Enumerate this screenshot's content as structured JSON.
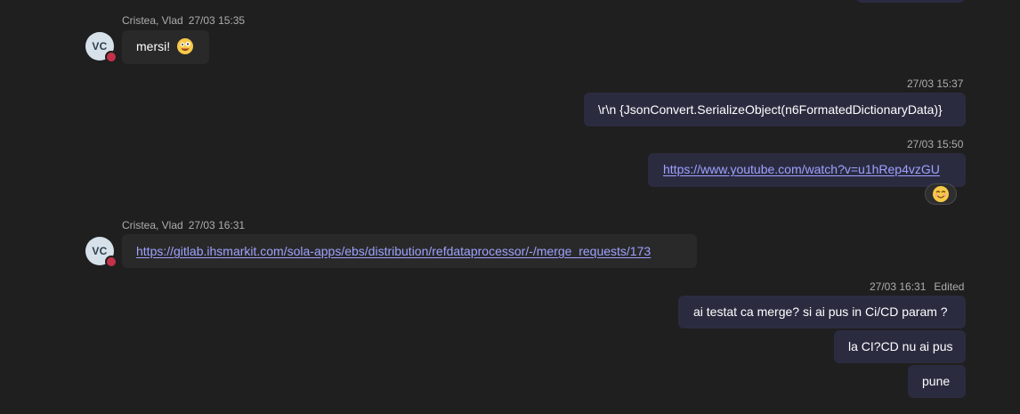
{
  "messages": {
    "msg1": {
      "sender": "Cristea, Vlad",
      "time": "27/03 15:35",
      "avatar": "VC",
      "text": "mersi!",
      "emoji": "zany-face-emoji"
    },
    "msg2": {
      "time": "27/03 15:37",
      "text": "\\r\\n {JsonConvert.SerializeObject(n6FormatedDictionaryData)}"
    },
    "msg3": {
      "time": "27/03 15:50",
      "link": "https://www.youtube.com/watch?v=u1hRep4vzGU",
      "reaction": "smiling-face-emoji"
    },
    "msg4": {
      "sender": "Cristea, Vlad",
      "time": "27/03 16:31",
      "avatar": "VC",
      "link": "https://gitlab.ihsmarkit.com/sola-apps/ebs/distribution/refdataprocessor/-/merge_requests/173"
    },
    "msg5": {
      "time": "27/03 16:31",
      "edited": "Edited",
      "lines": [
        "ai testat ca merge? si ai pus in Ci/CD param ?",
        "la CI?CD nu ai pus",
        "pune"
      ]
    }
  },
  "colors": {
    "background": "#1f1f1f",
    "incoming_bubble": "#292929",
    "outgoing_bubble": "#2b2b40",
    "link": "#9ea2ff",
    "presence_busy": "#c4314b"
  }
}
